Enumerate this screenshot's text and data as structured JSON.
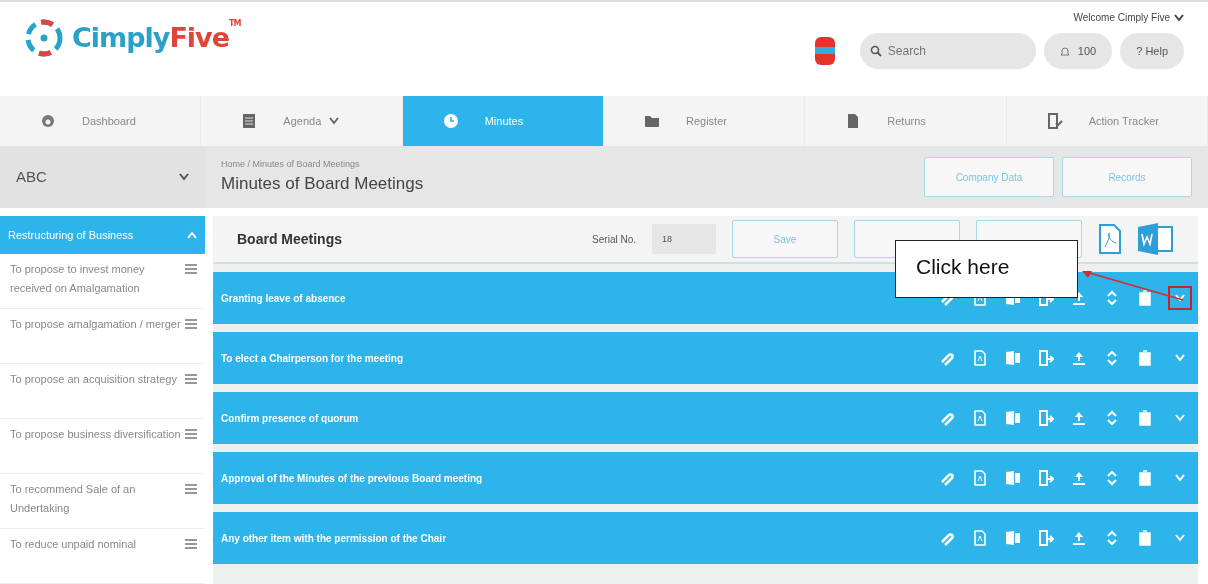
{
  "logo": {
    "text_main": "Cimply",
    "text_accent": "Five",
    "trademark": "TM"
  },
  "header": {
    "welcome": "Welcome Cimply Five",
    "search": {
      "placeholder": "Search"
    },
    "notifications": "100",
    "help": "? Help"
  },
  "nav": [
    {
      "label": "Dashboard",
      "dropdown": false,
      "selected": false
    },
    {
      "label": "Agenda",
      "dropdown": true,
      "selected": false
    },
    {
      "label": "Minutes",
      "dropdown": false,
      "selected": true
    },
    {
      "label": "Register",
      "dropdown": false,
      "selected": false
    },
    {
      "label": "Returns",
      "dropdown": false,
      "selected": false
    },
    {
      "label": "Action Tracker",
      "dropdown": false,
      "selected": false
    }
  ],
  "company_select": {
    "value": "ABC"
  },
  "breadcrumb": "Home / Minutes of Board Meetings",
  "page_title": "Minutes of Board Meetings",
  "page_buttons": [
    "Company Data",
    "Records"
  ],
  "sidebar": {
    "title": "Restructuring of Business",
    "expanded": true,
    "items": [
      "To propose to invest money received on Amalgamation",
      "To propose amalgamation / merger",
      "To propose an acquisition strategy",
      "To propose business diversification",
      "To recommend Sale of an Undertaking",
      "To reduce unpaid nominal"
    ]
  },
  "toolbar": {
    "title": "Board Meetings",
    "serial_label": "Serial No.",
    "serial_value": "18",
    "buttons": [
      "Save"
    ]
  },
  "agenda_rows": [
    {
      "title": "Granting leave of absence",
      "highlighted": true
    },
    {
      "title": "To elect a Chairperson for the meeting",
      "highlighted": false
    },
    {
      "title": "Confirm presence of quorum",
      "highlighted": false
    },
    {
      "title": "Approval of the Minutes of the previous Board meeting",
      "highlighted": false
    },
    {
      "title": "Any other item with the permission of the Chair",
      "highlighted": false
    }
  ],
  "callout": {
    "text": "Click here"
  }
}
